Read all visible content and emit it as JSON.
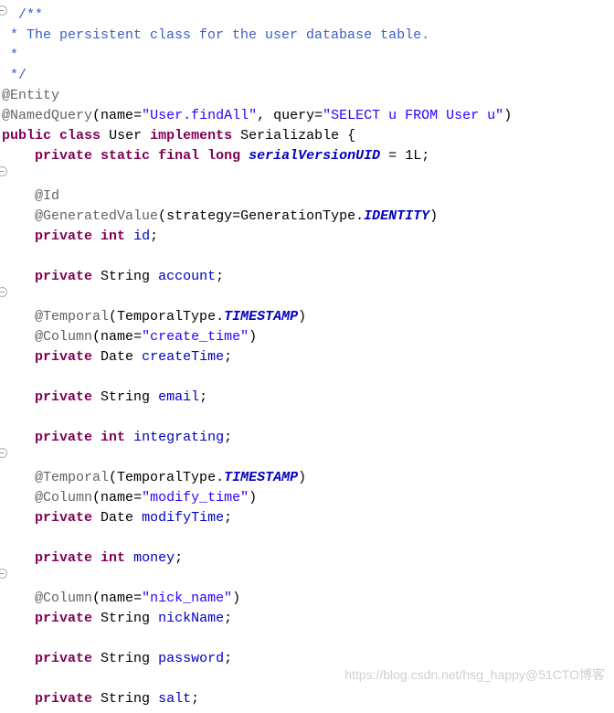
{
  "javadoc": {
    "open": "/**",
    "line1": " * The persistent class for the user database table.",
    "line2": " *",
    "close": " */"
  },
  "ann": {
    "entity": "@Entity",
    "namedQuery": "@NamedQuery",
    "id": "@Id",
    "generatedValue": "@GeneratedValue",
    "temporal": "@Temporal",
    "column": "@Column"
  },
  "nq": {
    "nameKey": "name",
    "nameVal": "\"User.findAll\"",
    "queryKey": "query",
    "queryVal": "\"SELECT u FROM User u\""
  },
  "gv": {
    "key": "strategy",
    "genType": "GenerationType.",
    "identity": "IDENTITY"
  },
  "temporal": {
    "type": "TemporalType.",
    "ts": "TIMESTAMP"
  },
  "colNames": {
    "createTime": "\"create_time\"",
    "modifyTime": "\"modify_time\"",
    "nickName": "\"nick_name\""
  },
  "kw": {
    "public": "public",
    "class": "class",
    "implements": "implements",
    "private": "private",
    "static": "static",
    "final": "final",
    "long": "long",
    "int": "int"
  },
  "types": {
    "user": "User",
    "serializable": "Serializable",
    "string": "String",
    "date": "Date"
  },
  "fields": {
    "svuid": "serialVersionUID",
    "svuidVal": "1L",
    "id": "id",
    "account": "account",
    "createTime": "createTime",
    "email": "email",
    "integrating": "integrating",
    "modifyTime": "modifyTime",
    "money": "money",
    "nickName": "nickName",
    "password": "password",
    "salt": "salt"
  },
  "sym": {
    "eq": " = ",
    "semi": ";",
    "openParen": "(",
    "closeParen": ")",
    "comma": ", ",
    "openBrace": " {",
    "assign": "="
  },
  "watermark": "https://blog.csdn.net/hsg_happy@51CTO博客"
}
